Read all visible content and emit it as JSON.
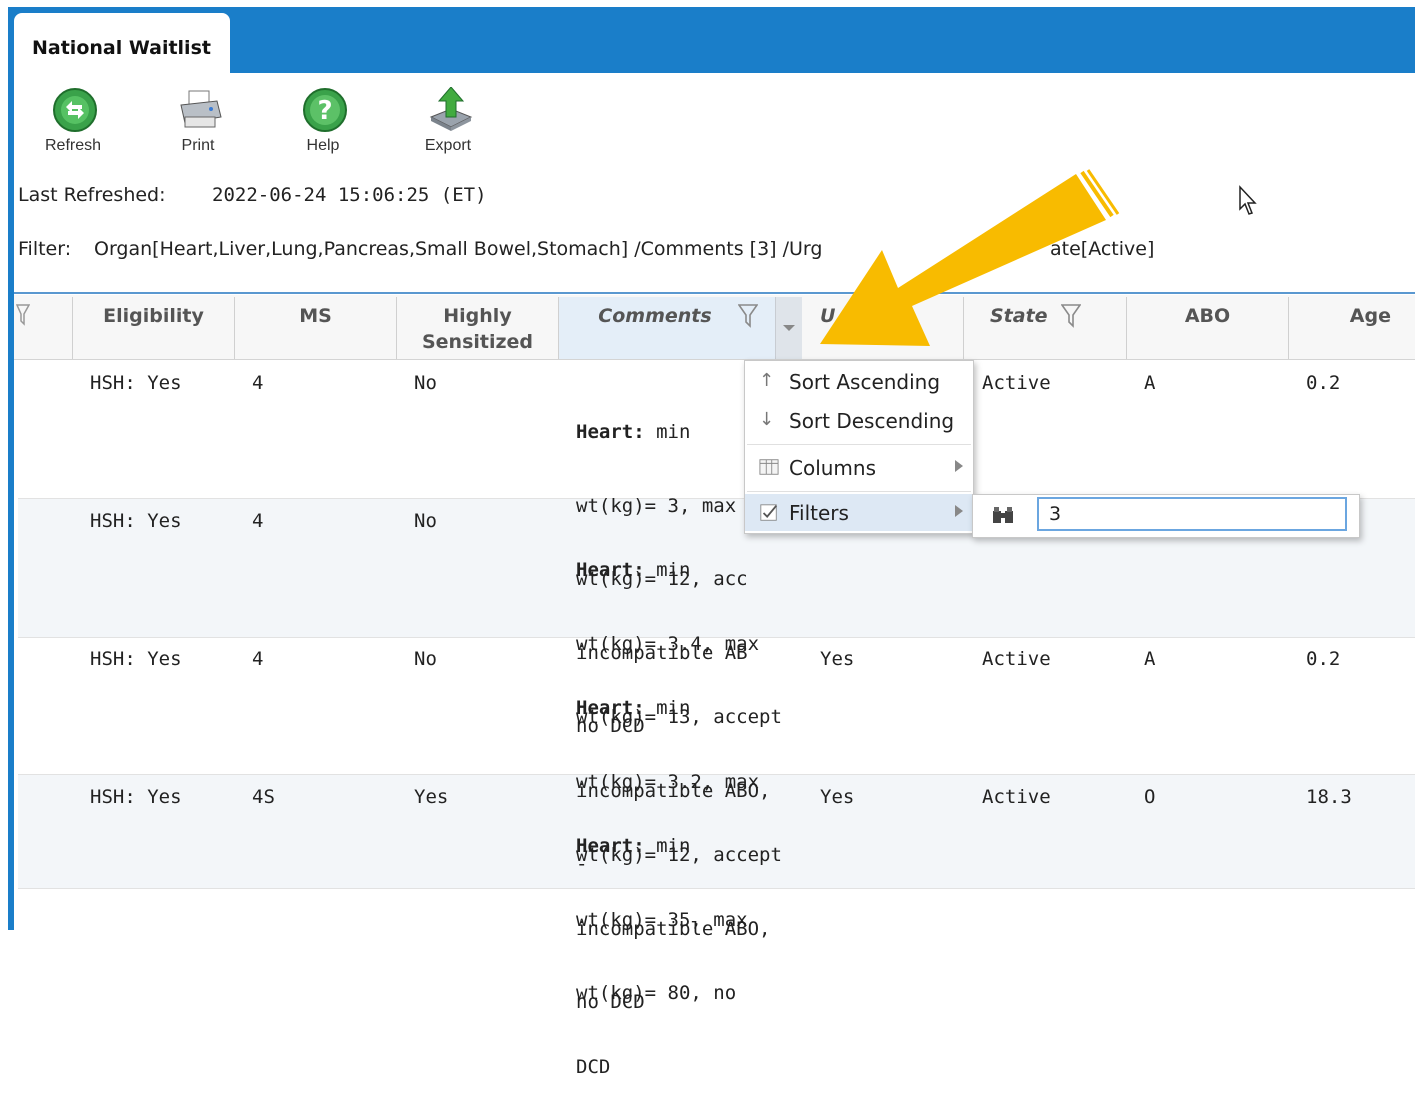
{
  "tab": {
    "title": "National Waitlist"
  },
  "toolbar": [
    {
      "label": "Refresh",
      "icon": "refresh-icon"
    },
    {
      "label": "Print",
      "icon": "printer-icon"
    },
    {
      "label": "Help",
      "icon": "help-icon"
    },
    {
      "label": "Export",
      "icon": "export-icon"
    }
  ],
  "last_refreshed": {
    "label": "Last Refreshed:",
    "value": "2022-06-24 15:06:25 (ET)"
  },
  "filter": {
    "label": "Filter:",
    "text_a": "Organ[Heart,Liver,Lung,Pancreas,Small Bowel,Stomach] /Comments [3] /Urg",
    "text_b": "ate[Active]"
  },
  "columns": {
    "eligibility": "Eligibility",
    "ms": "MS",
    "highly_1": "Highly",
    "highly_2": "Sensitized",
    "comments": "Comments",
    "urgent_partial": "U",
    "state": "State",
    "abo": "ABO",
    "age": "Age"
  },
  "rows": [
    {
      "eligibility": "HSH: Yes",
      "ms": "4",
      "highly": "No",
      "comment_bold": "Heart:",
      "comment_1": " min",
      "comment_2": "wt(kg)= 3, max",
      "comment_3": "wt(kg)= 12, acc",
      "comment_4": "incompatible AB",
      "comment_5": "no DCD",
      "urgent": "",
      "state": "Active",
      "abo": "A",
      "age": "0.2"
    },
    {
      "eligibility": "HSH: Yes",
      "ms": "4",
      "highly": "No",
      "comment_bold": "Heart:",
      "comment_1": " min",
      "comment_2": "wt(kg)= 3.4, max",
      "comment_3": "wt(kg)= 13, accept",
      "comment_4": "incompatible ABO,",
      "comment_5": "-",
      "urgent": "",
      "state": "",
      "abo": "",
      "age": ""
    },
    {
      "eligibility": "HSH: Yes",
      "ms": "4",
      "highly": "No",
      "comment_bold": "Heart:",
      "comment_1": " min",
      "comment_2": "wt(kg)= 3.2, max",
      "comment_3": "wt(kg)= 12, accept",
      "comment_4": "incompatible ABO,",
      "comment_5": "no DCD",
      "urgent": "Yes",
      "state": "Active",
      "abo": "A",
      "age": "0.2"
    },
    {
      "eligibility": "HSH: Yes",
      "ms": "4S",
      "highly": "Yes",
      "comment_bold": "Heart:",
      "comment_1": " min",
      "comment_2": "wt(kg)= 35, max",
      "comment_3": "wt(kg)= 80, no",
      "comment_4": "DCD",
      "comment_5": "",
      "urgent": "Yes",
      "state": "Active",
      "abo": "O",
      "age": "18.3"
    }
  ],
  "menu": {
    "sort_asc": "Sort Ascending",
    "sort_desc": "Sort Descending",
    "columns": "Columns",
    "filters": "Filters",
    "filter_value": "3"
  },
  "colors": {
    "header_blue": "#1a7ec9",
    "arrow": "#f8bb00"
  }
}
